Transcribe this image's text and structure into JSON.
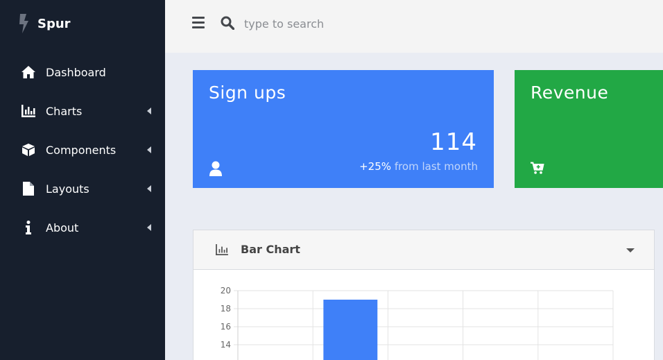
{
  "brand": {
    "name": "Spur"
  },
  "sidebar": {
    "items": [
      {
        "label": "Dashboard",
        "icon": "home-icon",
        "has_caret": false
      },
      {
        "label": "Charts",
        "icon": "bar-chart-icon",
        "has_caret": true
      },
      {
        "label": "Components",
        "icon": "cube-icon",
        "has_caret": true
      },
      {
        "label": "Layouts",
        "icon": "file-icon",
        "has_caret": true
      },
      {
        "label": "About",
        "icon": "info-icon",
        "has_caret": true
      }
    ]
  },
  "search": {
    "placeholder": "type to search",
    "value": ""
  },
  "cards": {
    "signups": {
      "title": "Sign ups",
      "value": "114",
      "change_pct": "+25%",
      "change_text": "from last month",
      "color": "#3f80f8"
    },
    "revenue": {
      "title": "Revenue",
      "color": "#22a845"
    }
  },
  "panel": {
    "title": "Bar Chart"
  },
  "chart_data": {
    "type": "bar",
    "categories": [
      "",
      "",
      "",
      "",
      ""
    ],
    "values": [
      null,
      19,
      null,
      null,
      null
    ],
    "y_ticks": [
      14,
      16,
      18,
      20
    ],
    "ylim": [
      12,
      20
    ],
    "grid": true,
    "bar_color": "#3f80f8"
  }
}
